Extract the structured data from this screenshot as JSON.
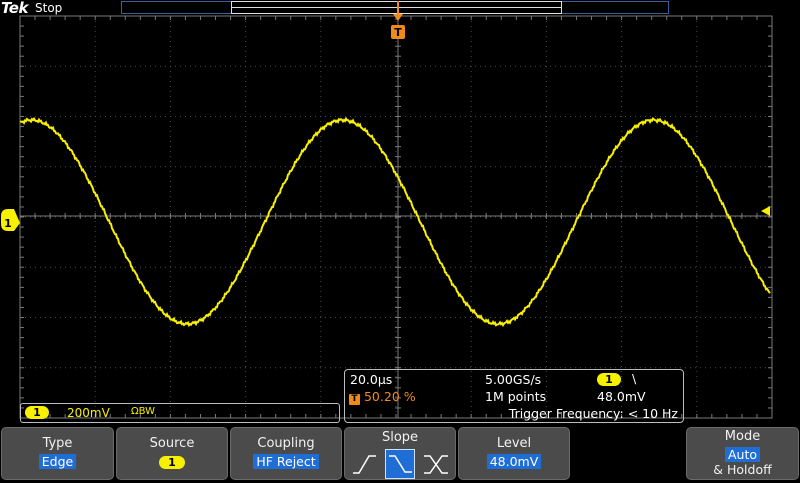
{
  "header": {
    "brand": "Tek",
    "run_state": "Stop",
    "trigger_marker": "T"
  },
  "channel1": {
    "marker": "1",
    "scale": "200mV",
    "bandwidth_symbol": "ΩBW"
  },
  "timebase": {
    "scale": "20.0µs",
    "trigger_position_marker": "T",
    "trigger_position": "50.20 %",
    "sample_rate": "5.00GS/s",
    "record_length": "1M points",
    "trigger_channel": "1",
    "trigger_slope_symbol": "\\",
    "trigger_level": "48.0mV",
    "trigger_frequency": "Trigger Frequency: < 10 Hz"
  },
  "menu": {
    "type": {
      "title": "Type",
      "value": "Edge"
    },
    "source": {
      "title": "Source",
      "value": "1"
    },
    "coupling": {
      "title": "Coupling",
      "value": "HF Reject"
    },
    "slope": {
      "title": "Slope",
      "selected": "falling"
    },
    "level": {
      "title": "Level",
      "value": "48.0mV"
    },
    "mode": {
      "title": "Mode",
      "value": "Auto",
      "extra": "& Holdoff"
    }
  },
  "colors": {
    "trace": "#f7f000",
    "trigger": "#f08a1c",
    "selection": "#1f6ed6",
    "grid": "#7a7a7a",
    "button": "#4b4b4b"
  }
}
